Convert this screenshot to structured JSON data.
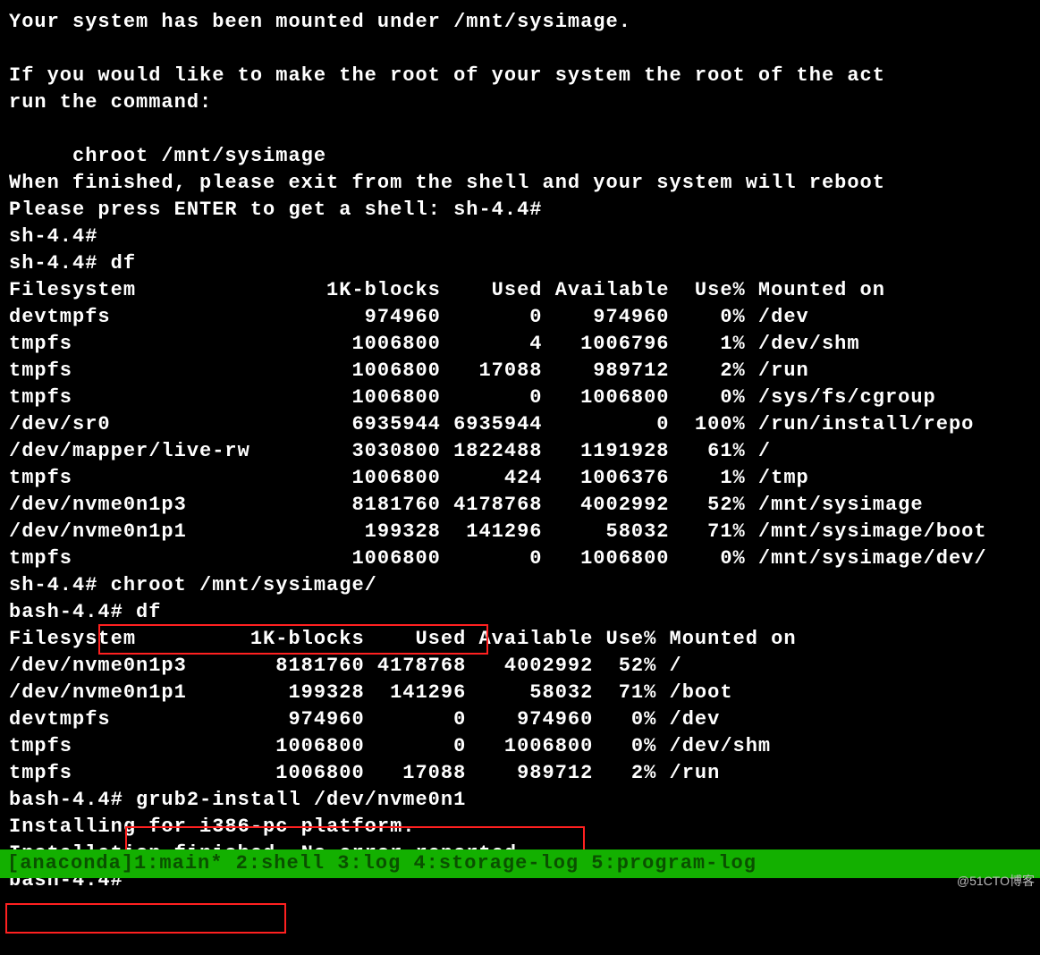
{
  "intro": {
    "line1": "Your system has been mounted under /mnt/sysimage.",
    "line2": "If you would like to make the root of your system the root of the act",
    "line3": "run the command:",
    "line4": "     chroot /mnt/sysimage",
    "line5": "When finished, please exit from the shell and your system will reboot",
    "line6": "Please press ENTER to get a shell: sh-4.4#"
  },
  "prompts": {
    "sh1": "sh-4.4#",
    "sh2": "sh-4.4# df",
    "sh3": "sh-4.4# chroot /mnt/sysimage/",
    "bash1": "bash-4.4# df",
    "bash2": "bash-4.4# grub2-install /dev/nvme0n1",
    "msg1": "Installing for i386-pc platform.",
    "msg2": "Installation finished. No error reported.",
    "bash3": "bash-4.4#"
  },
  "df1": {
    "header": {
      "fs": "Filesystem",
      "blocks": "1K-blocks",
      "used": "Used",
      "avail": "Available",
      "usep": "Use%",
      "mnt": "Mounted on"
    },
    "rows": [
      {
        "fs": "devtmpfs",
        "blocks": "974960",
        "used": "0",
        "avail": "974960",
        "usep": "0%",
        "mnt": "/dev"
      },
      {
        "fs": "tmpfs",
        "blocks": "1006800",
        "used": "4",
        "avail": "1006796",
        "usep": "1%",
        "mnt": "/dev/shm"
      },
      {
        "fs": "tmpfs",
        "blocks": "1006800",
        "used": "17088",
        "avail": "989712",
        "usep": "2%",
        "mnt": "/run"
      },
      {
        "fs": "tmpfs",
        "blocks": "1006800",
        "used": "0",
        "avail": "1006800",
        "usep": "0%",
        "mnt": "/sys/fs/cgroup"
      },
      {
        "fs": "/dev/sr0",
        "blocks": "6935944",
        "used": "6935944",
        "avail": "0",
        "usep": "100%",
        "mnt": "/run/install/repo"
      },
      {
        "fs": "/dev/mapper/live-rw",
        "blocks": "3030800",
        "used": "1822488",
        "avail": "1191928",
        "usep": "61%",
        "mnt": "/"
      },
      {
        "fs": "tmpfs",
        "blocks": "1006800",
        "used": "424",
        "avail": "1006376",
        "usep": "1%",
        "mnt": "/tmp"
      },
      {
        "fs": "/dev/nvme0n1p3",
        "blocks": "8181760",
        "used": "4178768",
        "avail": "4002992",
        "usep": "52%",
        "mnt": "/mnt/sysimage"
      },
      {
        "fs": "/dev/nvme0n1p1",
        "blocks": "199328",
        "used": "141296",
        "avail": "58032",
        "usep": "71%",
        "mnt": "/mnt/sysimage/boot"
      },
      {
        "fs": "tmpfs",
        "blocks": "1006800",
        "used": "0",
        "avail": "1006800",
        "usep": "0%",
        "mnt": "/mnt/sysimage/dev/"
      }
    ]
  },
  "df2": {
    "header": {
      "fs": "Filesystem",
      "blocks": "1K-blocks",
      "used": "Used",
      "avail": "Available",
      "usep": "Use%",
      "mnt": "Mounted on"
    },
    "rows": [
      {
        "fs": "/dev/nvme0n1p3",
        "blocks": "8181760",
        "used": "4178768",
        "avail": "4002992",
        "usep": "52%",
        "mnt": "/"
      },
      {
        "fs": "/dev/nvme0n1p1",
        "blocks": "199328",
        "used": "141296",
        "avail": "58032",
        "usep": "71%",
        "mnt": "/boot"
      },
      {
        "fs": "devtmpfs",
        "blocks": "974960",
        "used": "0",
        "avail": "974960",
        "usep": "0%",
        "mnt": "/dev"
      },
      {
        "fs": "tmpfs",
        "blocks": "1006800",
        "used": "0",
        "avail": "1006800",
        "usep": "0%",
        "mnt": "/dev/shm"
      },
      {
        "fs": "tmpfs",
        "blocks": "1006800",
        "used": "17088",
        "avail": "989712",
        "usep": "2%",
        "mnt": "/run"
      }
    ]
  },
  "statusbar": "[anaconda]1:main* 2:shell  3:log  4:storage-log  5:program-log",
  "watermark": "@51CTO博客"
}
